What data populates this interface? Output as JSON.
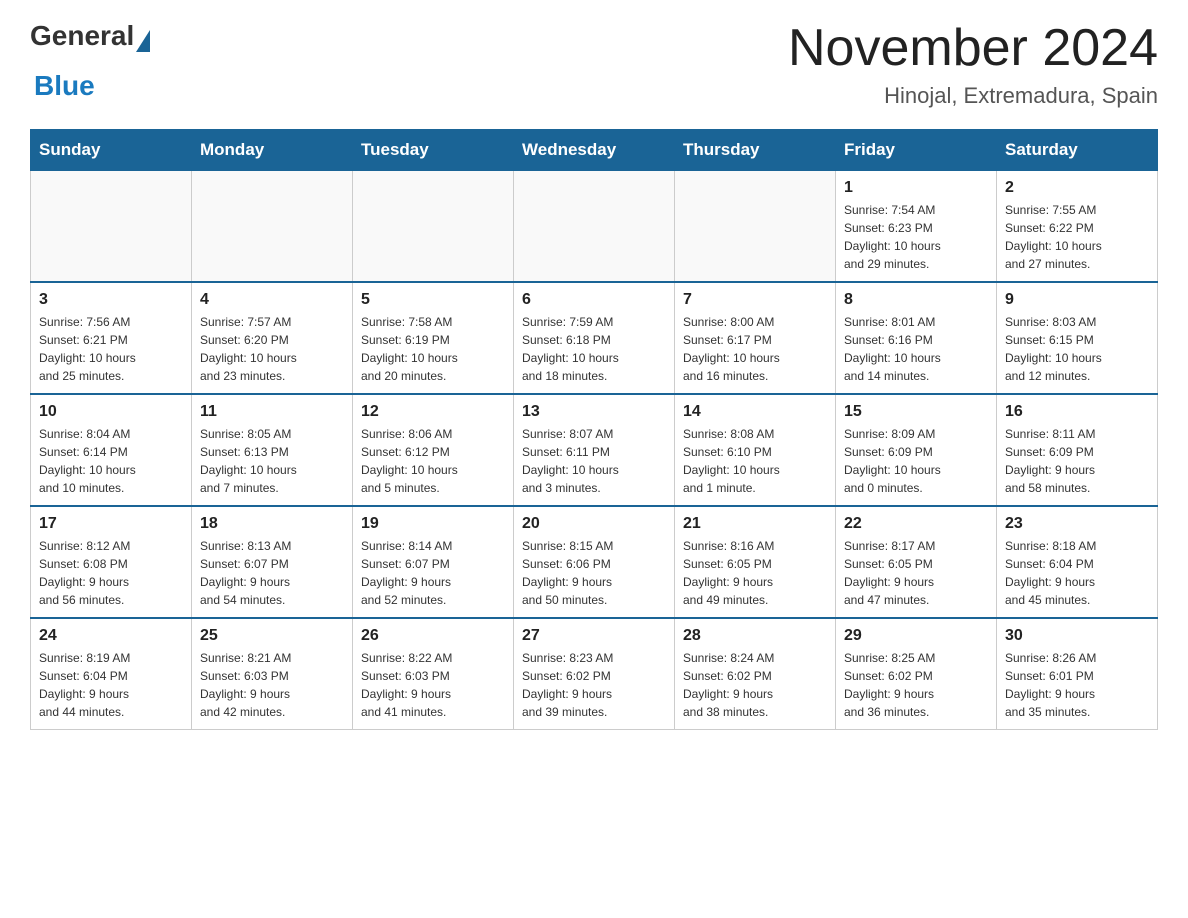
{
  "header": {
    "logo_general": "General",
    "logo_blue": "Blue",
    "month_title": "November 2024",
    "location": "Hinojal, Extremadura, Spain"
  },
  "days_of_week": [
    "Sunday",
    "Monday",
    "Tuesday",
    "Wednesday",
    "Thursday",
    "Friday",
    "Saturday"
  ],
  "weeks": [
    [
      {
        "day": "",
        "info": ""
      },
      {
        "day": "",
        "info": ""
      },
      {
        "day": "",
        "info": ""
      },
      {
        "day": "",
        "info": ""
      },
      {
        "day": "",
        "info": ""
      },
      {
        "day": "1",
        "info": "Sunrise: 7:54 AM\nSunset: 6:23 PM\nDaylight: 10 hours\nand 29 minutes."
      },
      {
        "day": "2",
        "info": "Sunrise: 7:55 AM\nSunset: 6:22 PM\nDaylight: 10 hours\nand 27 minutes."
      }
    ],
    [
      {
        "day": "3",
        "info": "Sunrise: 7:56 AM\nSunset: 6:21 PM\nDaylight: 10 hours\nand 25 minutes."
      },
      {
        "day": "4",
        "info": "Sunrise: 7:57 AM\nSunset: 6:20 PM\nDaylight: 10 hours\nand 23 minutes."
      },
      {
        "day": "5",
        "info": "Sunrise: 7:58 AM\nSunset: 6:19 PM\nDaylight: 10 hours\nand 20 minutes."
      },
      {
        "day": "6",
        "info": "Sunrise: 7:59 AM\nSunset: 6:18 PM\nDaylight: 10 hours\nand 18 minutes."
      },
      {
        "day": "7",
        "info": "Sunrise: 8:00 AM\nSunset: 6:17 PM\nDaylight: 10 hours\nand 16 minutes."
      },
      {
        "day": "8",
        "info": "Sunrise: 8:01 AM\nSunset: 6:16 PM\nDaylight: 10 hours\nand 14 minutes."
      },
      {
        "day": "9",
        "info": "Sunrise: 8:03 AM\nSunset: 6:15 PM\nDaylight: 10 hours\nand 12 minutes."
      }
    ],
    [
      {
        "day": "10",
        "info": "Sunrise: 8:04 AM\nSunset: 6:14 PM\nDaylight: 10 hours\nand 10 minutes."
      },
      {
        "day": "11",
        "info": "Sunrise: 8:05 AM\nSunset: 6:13 PM\nDaylight: 10 hours\nand 7 minutes."
      },
      {
        "day": "12",
        "info": "Sunrise: 8:06 AM\nSunset: 6:12 PM\nDaylight: 10 hours\nand 5 minutes."
      },
      {
        "day": "13",
        "info": "Sunrise: 8:07 AM\nSunset: 6:11 PM\nDaylight: 10 hours\nand 3 minutes."
      },
      {
        "day": "14",
        "info": "Sunrise: 8:08 AM\nSunset: 6:10 PM\nDaylight: 10 hours\nand 1 minute."
      },
      {
        "day": "15",
        "info": "Sunrise: 8:09 AM\nSunset: 6:09 PM\nDaylight: 10 hours\nand 0 minutes."
      },
      {
        "day": "16",
        "info": "Sunrise: 8:11 AM\nSunset: 6:09 PM\nDaylight: 9 hours\nand 58 minutes."
      }
    ],
    [
      {
        "day": "17",
        "info": "Sunrise: 8:12 AM\nSunset: 6:08 PM\nDaylight: 9 hours\nand 56 minutes."
      },
      {
        "day": "18",
        "info": "Sunrise: 8:13 AM\nSunset: 6:07 PM\nDaylight: 9 hours\nand 54 minutes."
      },
      {
        "day": "19",
        "info": "Sunrise: 8:14 AM\nSunset: 6:07 PM\nDaylight: 9 hours\nand 52 minutes."
      },
      {
        "day": "20",
        "info": "Sunrise: 8:15 AM\nSunset: 6:06 PM\nDaylight: 9 hours\nand 50 minutes."
      },
      {
        "day": "21",
        "info": "Sunrise: 8:16 AM\nSunset: 6:05 PM\nDaylight: 9 hours\nand 49 minutes."
      },
      {
        "day": "22",
        "info": "Sunrise: 8:17 AM\nSunset: 6:05 PM\nDaylight: 9 hours\nand 47 minutes."
      },
      {
        "day": "23",
        "info": "Sunrise: 8:18 AM\nSunset: 6:04 PM\nDaylight: 9 hours\nand 45 minutes."
      }
    ],
    [
      {
        "day": "24",
        "info": "Sunrise: 8:19 AM\nSunset: 6:04 PM\nDaylight: 9 hours\nand 44 minutes."
      },
      {
        "day": "25",
        "info": "Sunrise: 8:21 AM\nSunset: 6:03 PM\nDaylight: 9 hours\nand 42 minutes."
      },
      {
        "day": "26",
        "info": "Sunrise: 8:22 AM\nSunset: 6:03 PM\nDaylight: 9 hours\nand 41 minutes."
      },
      {
        "day": "27",
        "info": "Sunrise: 8:23 AM\nSunset: 6:02 PM\nDaylight: 9 hours\nand 39 minutes."
      },
      {
        "day": "28",
        "info": "Sunrise: 8:24 AM\nSunset: 6:02 PM\nDaylight: 9 hours\nand 38 minutes."
      },
      {
        "day": "29",
        "info": "Sunrise: 8:25 AM\nSunset: 6:02 PM\nDaylight: 9 hours\nand 36 minutes."
      },
      {
        "day": "30",
        "info": "Sunrise: 8:26 AM\nSunset: 6:01 PM\nDaylight: 9 hours\nand 35 minutes."
      }
    ]
  ]
}
